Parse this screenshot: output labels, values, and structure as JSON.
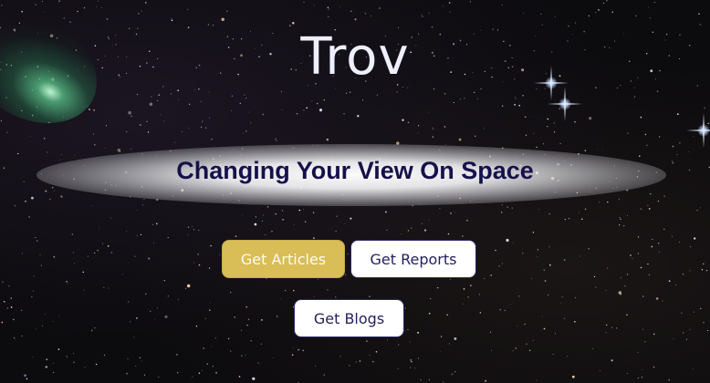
{
  "hero": {
    "title": "Trov",
    "tagline": "Changing Your View On Space"
  },
  "buttons": {
    "articles_label": "Get Articles",
    "reports_label": "Get Reports",
    "blogs_label": "Get Blogs"
  },
  "colors": {
    "primary_button": "#d9bd57",
    "secondary_button_text": "#24215f",
    "tagline_text": "#16114a",
    "title_text": "#eef0ff"
  },
  "background": "starfield-with-comet"
}
